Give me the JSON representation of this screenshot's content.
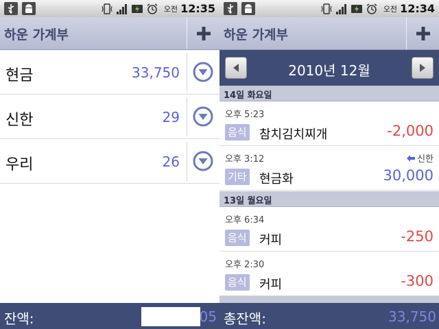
{
  "status_left": {
    "ampm": "오전",
    "time": "12:35"
  },
  "status_right": {
    "ampm": "오전",
    "time": "12:34"
  },
  "app_title": "하운 가계부",
  "accounts": [
    {
      "name": "현금",
      "balance": "33,750"
    },
    {
      "name": "신한",
      "balance": "29"
    },
    {
      "name": "우리",
      "balance": "26"
    }
  ],
  "left_bottom": {
    "label": "잔액:",
    "value": "05"
  },
  "right_bottom": {
    "label": "총잔액:",
    "value": "33,750"
  },
  "month": "2010년 12월",
  "days": [
    {
      "header": "14일 화요일",
      "entries": [
        {
          "time": "오후 5:23",
          "category": "음식",
          "desc": "참치김치찌개",
          "amount": "-2,000"
        },
        {
          "time": "오후 3:12",
          "category": "기타",
          "desc": "현금화",
          "amount": "30,000",
          "transfer": "신한"
        }
      ]
    },
    {
      "header": "13일 월요일",
      "entries": [
        {
          "time": "오후 6:34",
          "category": "음식",
          "desc": "커피",
          "amount": "-250"
        },
        {
          "time": "오후 2:30",
          "category": "음식",
          "desc": "커피",
          "amount": "-300"
        }
      ]
    }
  ],
  "colors": {
    "accent_blue": "#5b63d6",
    "negative_red": "#e24848",
    "nav_bar": "#3f4c75",
    "category_tag": "#b7badf"
  },
  "icons": {
    "usb": "usb-icon",
    "android": "android-icon",
    "vibrate": "vibrate-icon",
    "signal": "signal-icon",
    "battery": "battery-icon",
    "alarm": "alarm-icon",
    "add": "plus-icon",
    "dropdown": "chevron-down-icon",
    "prev": "triangle-left-icon",
    "next": "triangle-right-icon",
    "transfer": "arrow-left-icon"
  }
}
